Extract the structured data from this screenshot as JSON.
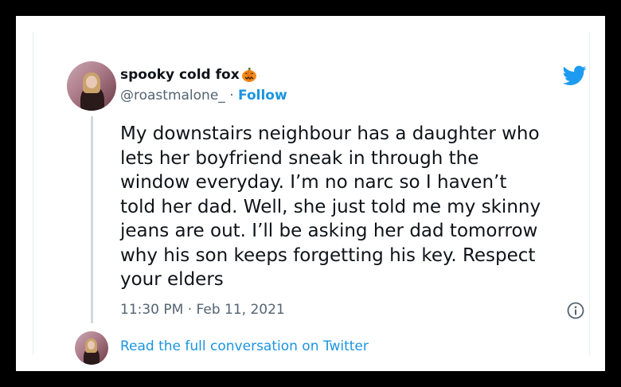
{
  "tweet": {
    "display_name": "spooky cold fox",
    "name_emoji": "pumpkin-icon",
    "handle": "@roastmalone_",
    "separator": " · ",
    "follow_label": "Follow",
    "text": "My downstairs neighbour has a daughter who\nlets her boyfriend sneak in through the\nwindow everyday. I’m no narc so I haven’t\ntold her dad. Well, she just told me my skinny\njeans are out. I’ll be asking her dad tomorrow\nwhy his son keeps forgetting his key. Respect\nyour elders",
    "timestamp": "11:30 PM · Feb 11, 2021"
  },
  "footer": {
    "read_link": "Read the full conversation on Twitter"
  },
  "colors": {
    "link": "#1b95e0",
    "secondary_text": "#536471",
    "thread_line": "#cfd9de"
  },
  "icons": [
    "twitter-bird-icon",
    "info-icon",
    "pumpkin-icon"
  ]
}
